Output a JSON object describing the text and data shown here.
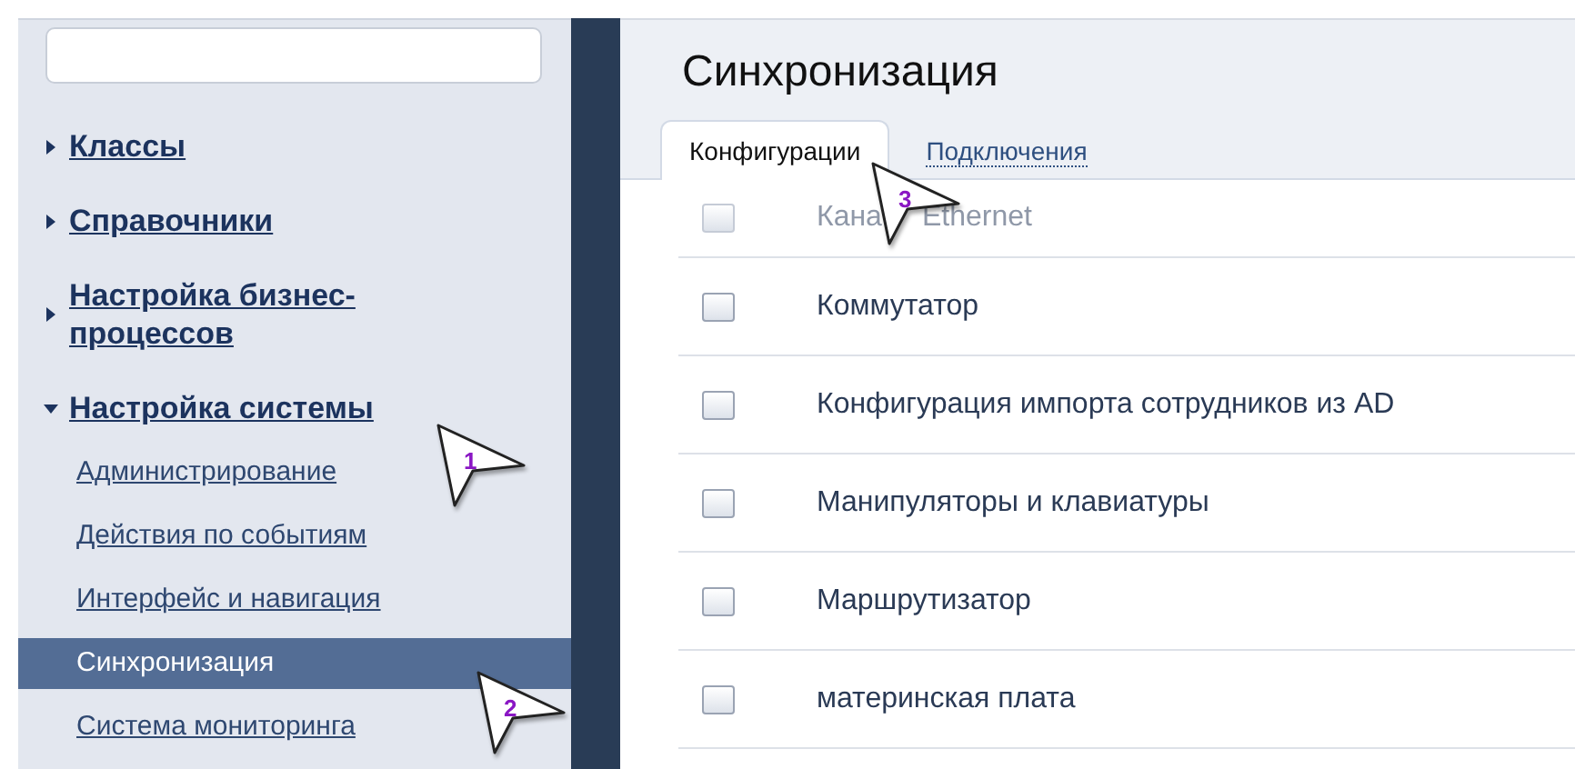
{
  "sidebar": {
    "items": [
      {
        "label": "Классы",
        "expanded": false
      },
      {
        "label": "Справочники",
        "expanded": false
      },
      {
        "label": "Настройка бизнес-процессов",
        "expanded": false
      },
      {
        "label": "Настройка системы",
        "expanded": true,
        "children": [
          {
            "label": "Администрирование",
            "selected": false
          },
          {
            "label": "Действия по событиям",
            "selected": false
          },
          {
            "label": "Интерфейс и навигация",
            "selected": false
          },
          {
            "label": "Синхронизация",
            "selected": true
          },
          {
            "label": "Система мониторинга",
            "selected": false
          }
        ]
      }
    ]
  },
  "main": {
    "title": "Синхронизация",
    "tabs": [
      {
        "label": "Конфигурации",
        "selected": true
      },
      {
        "label": "Подключения",
        "selected": false
      }
    ],
    "rows": [
      {
        "label": "Кана",
        "label_after_cursor": "Ethernet",
        "checked": false,
        "faded": true
      },
      {
        "label": "Коммутатор",
        "checked": false,
        "faded": false
      },
      {
        "label": "Конфигурация импорта сотрудников из AD",
        "checked": false,
        "faded": false
      },
      {
        "label": "Манипуляторы и клавиатуры",
        "checked": false,
        "faded": false
      },
      {
        "label": "Маршрутизатор",
        "checked": false,
        "faded": false
      },
      {
        "label": "материнская плата",
        "checked": false,
        "faded": false
      }
    ]
  },
  "callouts": [
    {
      "label": "1"
    },
    {
      "label": "2"
    },
    {
      "label": "3"
    }
  ]
}
